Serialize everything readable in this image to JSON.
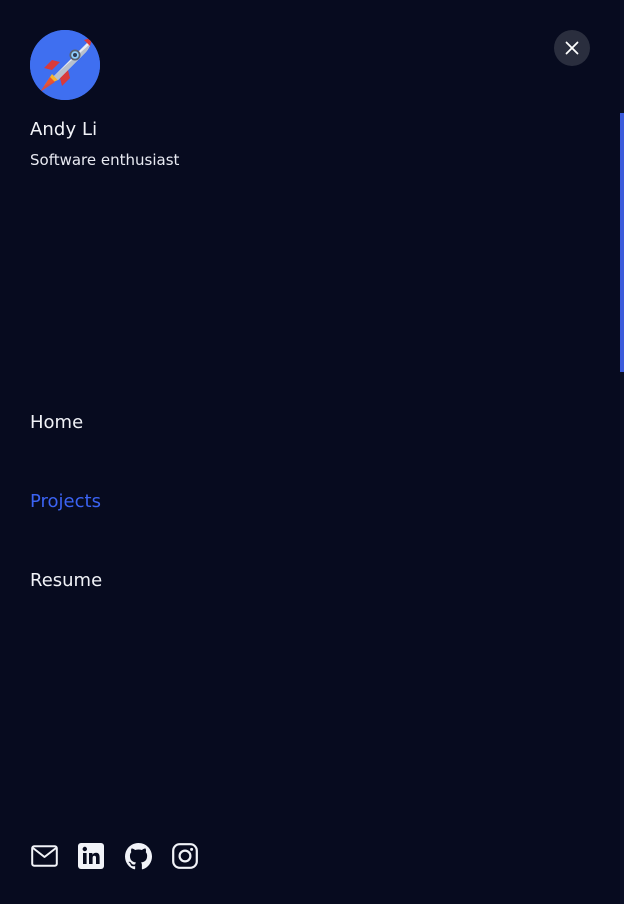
{
  "profile": {
    "name": "Andy Li",
    "tagline": "Software enthusiast",
    "avatar_icon": "rocket-icon"
  },
  "close_button": {
    "icon": "close-icon"
  },
  "nav": {
    "items": [
      {
        "label": "Home",
        "active": false
      },
      {
        "label": "Projects",
        "active": true
      },
      {
        "label": "Resume",
        "active": false
      }
    ]
  },
  "social": [
    {
      "icon": "mail-icon"
    },
    {
      "icon": "linkedin-icon"
    },
    {
      "icon": "github-icon"
    },
    {
      "icon": "instagram-icon"
    }
  ],
  "colors": {
    "background": "#070b1f",
    "accent": "#3b63f3",
    "text": "#f1f3f8",
    "close_button_bg": "#2a2e3e",
    "avatar_bg": "#3f6ff0"
  }
}
